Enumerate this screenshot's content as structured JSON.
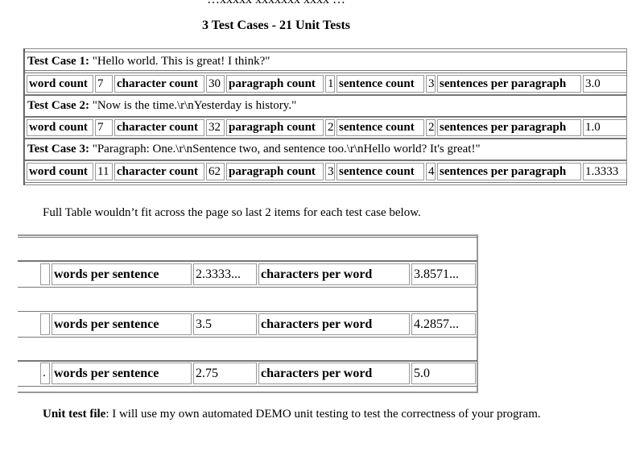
{
  "cut_off_text": "…xxxxx xxxxxxx xxxx …",
  "title": "3 Test Cases - 21 Unit Tests",
  "test_cases": [
    {
      "label": "Test Case 1:",
      "input": "\"Hello world. This is great! I think?\"",
      "metrics": [
        {
          "name": "word count",
          "value": "7"
        },
        {
          "name": "character count",
          "value": "30"
        },
        {
          "name": "paragraph count",
          "value": "1"
        },
        {
          "name": "sentence count",
          "value": "3"
        },
        {
          "name": "sentences per paragraph",
          "value": "3.0"
        }
      ],
      "extra": [
        {
          "name": "words per sentence",
          "value": "2.3333..."
        },
        {
          "name": "characters per word",
          "value": "3.8571..."
        }
      ]
    },
    {
      "label": "Test Case 2:",
      "input": "\"Now is the time.\\r\\nYesterday is history.\"",
      "metrics": [
        {
          "name": "word count",
          "value": "7"
        },
        {
          "name": "character count",
          "value": "32"
        },
        {
          "name": "paragraph count",
          "value": "2"
        },
        {
          "name": "sentence count",
          "value": "2"
        },
        {
          "name": "sentences per paragraph",
          "value": "1.0"
        }
      ],
      "extra": [
        {
          "name": "words per sentence",
          "value": "3.5"
        },
        {
          "name": "characters per word",
          "value": "4.2857..."
        }
      ]
    },
    {
      "label": "Test Case 3:",
      "input": "\"Paragraph: One.\\r\\nSentence two, and sentence too.\\r\\nHello world? It's great!\"",
      "metrics": [
        {
          "name": "word count",
          "value": "11"
        },
        {
          "name": "character count",
          "value": "62"
        },
        {
          "name": "paragraph count",
          "value": "3"
        },
        {
          "name": "sentence count",
          "value": "4"
        },
        {
          "name": "sentences per paragraph",
          "value": "1.3333"
        }
      ],
      "extra": [
        {
          "name": "words per sentence",
          "value": "2.75"
        },
        {
          "name": "characters per word",
          "value": "5.0"
        }
      ]
    }
  ],
  "note": "Full Table wouldn’t fit across the page  so last 2 items for each test case below.",
  "unit_test_label": "Unit test file",
  "unit_test_text": ": I will use my own automated DEMO unit testing to test the correctness of your program."
}
